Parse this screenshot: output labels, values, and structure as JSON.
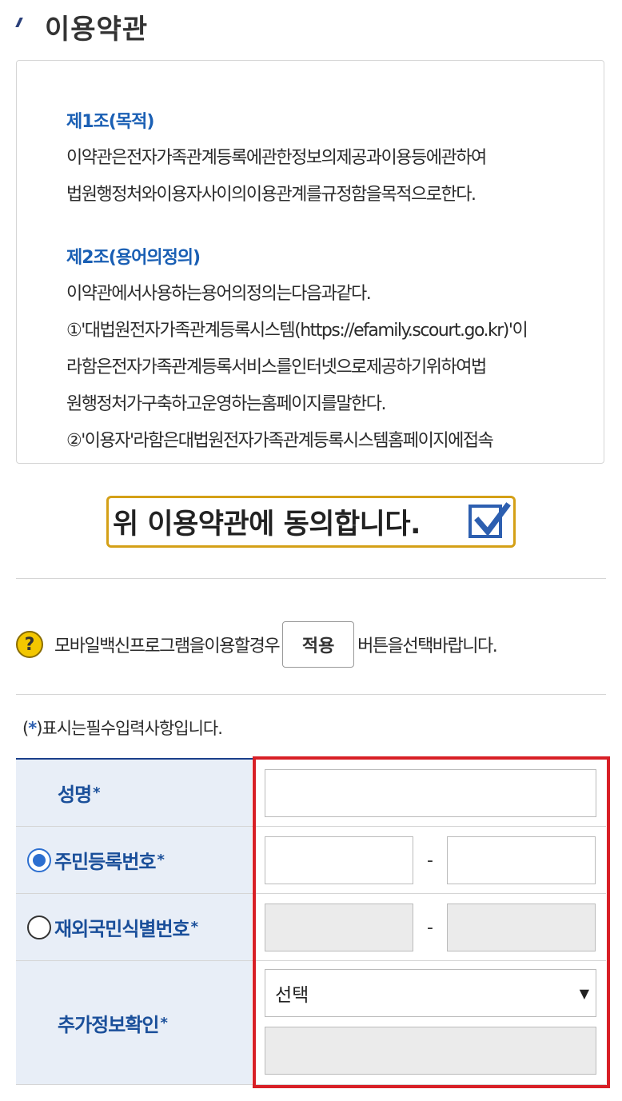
{
  "section": {
    "title": "이용약관"
  },
  "terms": {
    "article1_title": "제1조(목적)",
    "article1_lines": [
      "이약관은전자가족관계등록에관한정보의제공과이용등에관하여",
      "법원행정처와이용자사이의이용관계를규정함을목적으로한다."
    ],
    "article2_title": "제2조(용어의정의)",
    "article2_lines": [
      "이약관에서사용하는용어의정의는다음과같다.",
      "①'대법원전자가족관계등록시스템(https://efamily.scourt.go.kr)'이",
      "라함은전자가족관계등록서비스를인터넷으로제공하기위하여법",
      "원행정처가구축하고운영하는홈페이지를말한다.",
      "②'이용자'라함은대법원전자가족관계등록시스템홈페이지에접속"
    ]
  },
  "agree": {
    "label": "위 이용약관에 동의합니다.",
    "checked": true
  },
  "notice": {
    "before": "모바일백신프로그램을이용할경우",
    "button": "적용",
    "after": "버튼을선택바랍니다."
  },
  "required_note": {
    "open": "(",
    "star": "*",
    "rest": ")표시는필수입력사항입니다."
  },
  "form": {
    "name_label": "성명",
    "rrn_label": "주민등록번호",
    "foreign_label": "재외국민식별번호",
    "extra_label": "추가정보확인",
    "star": "*",
    "dash": "-",
    "select_value": "선택",
    "selected_id_type": "주민등록번호"
  },
  "colors": {
    "accent": "#1a4f9a",
    "agree_border": "#d4a017",
    "highlight": "#d81f26"
  }
}
